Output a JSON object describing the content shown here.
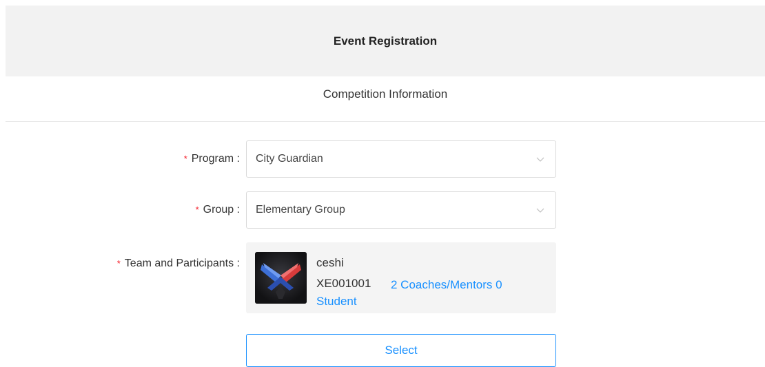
{
  "header": {
    "title": "Event Registration"
  },
  "section": {
    "title": "Competition Information"
  },
  "form": {
    "program": {
      "label": "Program :",
      "required_mark": "*",
      "value": "City Guardian"
    },
    "group": {
      "label": "Group :",
      "required_mark": "*",
      "value": "Elementary Group"
    },
    "team": {
      "label": "Team and Participants :",
      "required_mark": "*",
      "name": "ceshi",
      "code": "XE001001",
      "members_link": "2 Coaches/Mentors 0 Student"
    },
    "select_button": {
      "label": "Select"
    }
  },
  "colors": {
    "accent": "#1890ff",
    "required": "#f5222d",
    "header_bg": "#f2f2f2"
  },
  "icons": {
    "dropdown": "chevron-down-icon",
    "team_avatar": "team-logo-icon"
  }
}
